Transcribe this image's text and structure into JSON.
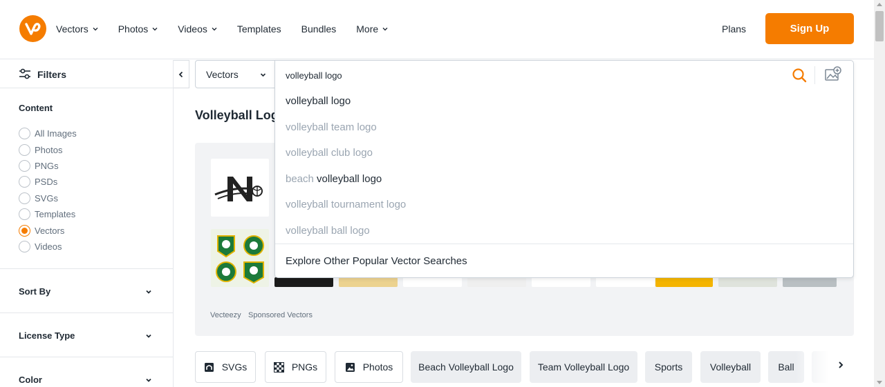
{
  "header": {
    "nav": [
      {
        "label": "Vectors",
        "dropdown": true
      },
      {
        "label": "Photos",
        "dropdown": true
      },
      {
        "label": "Videos",
        "dropdown": true
      },
      {
        "label": "Templates",
        "dropdown": false
      },
      {
        "label": "Bundles",
        "dropdown": false
      },
      {
        "label": "More",
        "dropdown": true
      }
    ],
    "plans": "Plans",
    "signup": "Sign Up",
    "brand_color": "#f57c00"
  },
  "sidebar": {
    "filters_label": "Filters",
    "content_title": "Content",
    "content_options": [
      {
        "label": "All Images",
        "checked": false
      },
      {
        "label": "Photos",
        "checked": false
      },
      {
        "label": "PNGs",
        "checked": false
      },
      {
        "label": "PSDs",
        "checked": false
      },
      {
        "label": "SVGs",
        "checked": false
      },
      {
        "label": "Templates",
        "checked": false
      },
      {
        "label": "Vectors",
        "checked": true
      },
      {
        "label": "Videos",
        "checked": false
      }
    ],
    "sections": [
      "Sort By",
      "License Type",
      "Color"
    ]
  },
  "search": {
    "type_selected": "Vectors",
    "query": "volleyball logo",
    "suggestions": [
      {
        "prefix": "",
        "bold": "volleyball logo",
        "suffix": "",
        "strong": true
      },
      {
        "prefix": "volleyball team logo",
        "bold": "",
        "suffix": "",
        "strong": false
      },
      {
        "prefix": "volleyball club logo",
        "bold": "",
        "suffix": "",
        "strong": false
      },
      {
        "prefix": "beach ",
        "bold": "volleyball logo",
        "suffix": "",
        "strong": false
      },
      {
        "prefix": "volleyball tournament logo",
        "bold": "",
        "suffix": "",
        "strong": false
      },
      {
        "prefix": "volleyball ball logo",
        "bold": "",
        "suffix": "",
        "strong": false
      }
    ],
    "explore": "Explore Other Popular Vector Searches"
  },
  "main": {
    "page_title": "Volleyball Log",
    "sponsored": {
      "source": "Vecteezy",
      "label": "Sponsored Vectors"
    }
  },
  "chips": [
    {
      "label": "SVGs",
      "icon": "svg-file-icon",
      "style": "white"
    },
    {
      "label": "PNGs",
      "icon": "checkerboard-icon",
      "style": "white"
    },
    {
      "label": "Photos",
      "icon": "photo-icon",
      "style": "white"
    },
    {
      "label": "Beach Volleyball Logo",
      "icon": "",
      "style": "grey"
    },
    {
      "label": "Team Volleyball Logo",
      "icon": "",
      "style": "grey"
    },
    {
      "label": "Sports",
      "icon": "",
      "style": "grey"
    },
    {
      "label": "Volleyball",
      "icon": "",
      "style": "grey"
    },
    {
      "label": "Ball",
      "icon": "",
      "style": "grey"
    }
  ]
}
